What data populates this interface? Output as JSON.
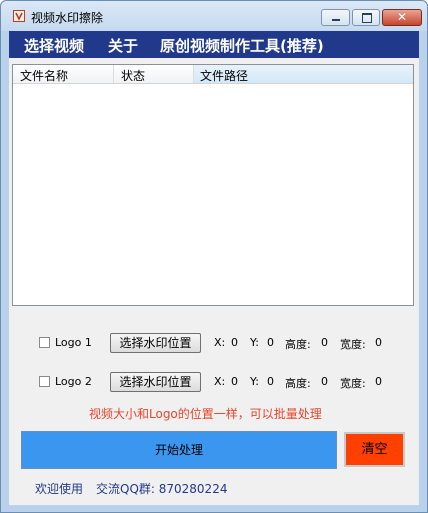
{
  "window": {
    "title": "视频水印擦除"
  },
  "menu": {
    "items": [
      "选择视频",
      "关于",
      "原创视频制作工具(推荐)"
    ]
  },
  "file_list": {
    "columns": [
      "文件名称",
      "状态",
      "文件路径"
    ],
    "rows": []
  },
  "logo_rows": [
    {
      "label": "Logo 1",
      "checked": false,
      "button": "选择水印位置",
      "x_label": "X:",
      "x": "0",
      "y_label": "Y:",
      "y": "0",
      "height_label": "高度:",
      "height": "0",
      "width_label": "宽度:",
      "width": "0"
    },
    {
      "label": "Logo 2",
      "checked": false,
      "button": "选择水印位置",
      "x_label": "X:",
      "x": "0",
      "y_label": "Y:",
      "y": "0",
      "height_label": "高度:",
      "height": "0",
      "width_label": "宽度:",
      "width": "0"
    }
  ],
  "hint": "视频大小和Logo的位置一样，可以批量处理",
  "actions": {
    "start": "开始处理",
    "clear": "清空"
  },
  "footer": {
    "welcome": "欢迎使用",
    "qq_group": "交流QQ群: 870280224"
  },
  "colors": {
    "menubar": "#21398b",
    "start": "#3b96f0",
    "clear": "#ff4000",
    "hint": "#e8452a"
  }
}
